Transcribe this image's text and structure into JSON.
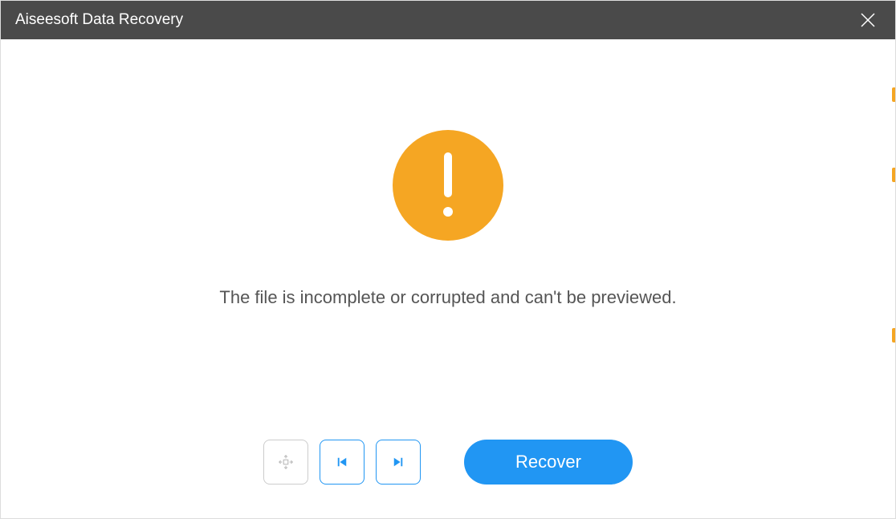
{
  "titlebar": {
    "title": "Aiseesoft Data Recovery"
  },
  "content": {
    "message": "The file is incomplete or corrupted and can't be previewed."
  },
  "toolbar": {
    "recover_label": "Recover"
  },
  "colors": {
    "accent": "#2196f3",
    "warning": "#f5a623",
    "titlebar": "#4a4a4a"
  }
}
